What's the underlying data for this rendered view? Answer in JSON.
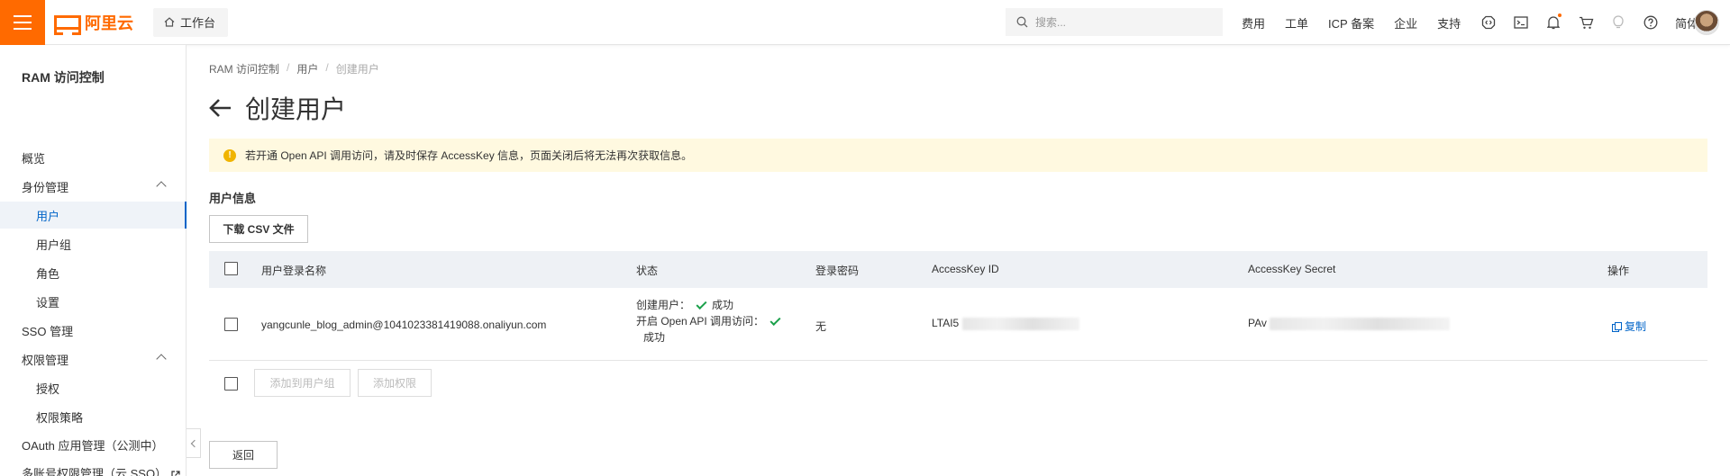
{
  "brand": {
    "name": "阿里云",
    "accent": "#ff6a00"
  },
  "topbar": {
    "workbench_label": "工作台",
    "search_placeholder": "搜索...",
    "nav": [
      "费用",
      "工单",
      "ICP 备案",
      "企业",
      "支持"
    ],
    "language": "简体",
    "icons": [
      "code-icon",
      "terminal-icon",
      "bell-icon",
      "cart-icon",
      "bulb-icon",
      "help-icon"
    ]
  },
  "sidebar": {
    "title": "RAM 访问控制",
    "items": [
      {
        "label": "概览"
      },
      {
        "label": "身份管理"
      },
      {
        "label": "用户"
      },
      {
        "label": "用户组"
      },
      {
        "label": "角色"
      },
      {
        "label": "设置"
      },
      {
        "label": "SSO 管理"
      },
      {
        "label": "权限管理"
      },
      {
        "label": "授权"
      },
      {
        "label": "权限策略"
      },
      {
        "label": "OAuth 应用管理（公测中）"
      },
      {
        "label": "多账号权限管理（云 SSO）"
      }
    ]
  },
  "breadcrumb": [
    "RAM 访问控制",
    "用户",
    "创建用户"
  ],
  "page_title": "创建用户",
  "alert": {
    "text": "若开通 Open API 调用访问，请及时保存 AccessKey 信息，页面关闭后将无法再次获取信息。",
    "color": "#fff9e0"
  },
  "section_title": "用户信息",
  "download_button": "下载 CSV 文件",
  "table": {
    "columns": [
      "用户登录名称",
      "状态",
      "登录密码",
      "AccessKey ID",
      "AccessKey Secret",
      "操作"
    ],
    "rows": [
      {
        "login_name": "yangcunle_blog_admin@1041023381419088.onaliyun.com",
        "status_created": "创建用户：",
        "status_created_result": "成功",
        "status_api": "开启 Open API 调用访问：",
        "status_api_result": "成功",
        "password": "无",
        "accesskey_id": "LTAI5",
        "accesskey_secret": "PAv",
        "action": "复制"
      }
    ]
  },
  "footer_buttons": {
    "add_to_group": "添加到用户组",
    "add_permission": "添加权限"
  },
  "back_button": "返回"
}
